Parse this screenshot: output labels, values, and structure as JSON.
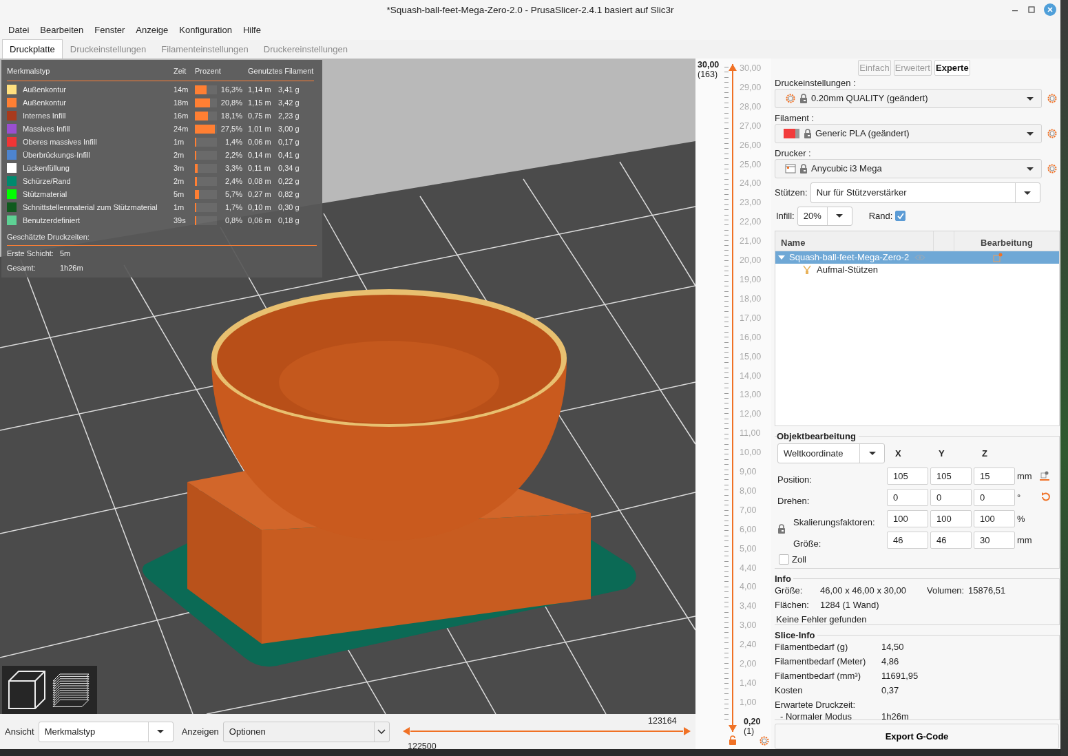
{
  "window": {
    "title": "*Squash-ball-feet-Mega-Zero-2.0 - PrusaSlicer-2.4.1 basiert auf Slic3r"
  },
  "menu": [
    "Datei",
    "Bearbeiten",
    "Fenster",
    "Anzeige",
    "Konfiguration",
    "Hilfe"
  ],
  "tabs": [
    {
      "label": "Druckplatte",
      "selected": true
    },
    {
      "label": "Druckeinstellungen",
      "selected": false
    },
    {
      "label": "Filamenteinstellungen",
      "selected": false
    },
    {
      "label": "Druckereinstellungen",
      "selected": false
    }
  ],
  "legend": {
    "columns": [
      "Merkmalstyp",
      "Zeit",
      "Prozent",
      "Genutztes Filament"
    ],
    "rows": [
      {
        "name": "Außenkontur",
        "color": "#ffe07f",
        "time": "14m",
        "level": 0.54,
        "percent": "16,3%",
        "length": "1,14 m",
        "weight": "3,41 g"
      },
      {
        "name": "Außenkontur",
        "color": "#ff7f33",
        "time": "18m",
        "level": 0.69,
        "percent": "20,8%",
        "length": "1,15 m",
        "weight": "3,42 g"
      },
      {
        "name": "Internes Infill",
        "color": "#a83a1c",
        "time": "16m",
        "level": 0.6,
        "percent": "18,1%",
        "length": "0,75 m",
        "weight": "2,23 g"
      },
      {
        "name": "Massives Infill",
        "color": "#9a4fd0",
        "time": "24m",
        "level": 0.92,
        "percent": "27,5%",
        "length": "1,01 m",
        "weight": "3,00 g"
      },
      {
        "name": "Oberes massives Infill",
        "color": "#f03535",
        "time": "1m",
        "level": 0.05,
        "percent": "1,4%",
        "length": "0,06 m",
        "weight": "0,17 g"
      },
      {
        "name": "Überbrückungs-Infill",
        "color": "#4d84cf",
        "time": "2m",
        "level": 0.07,
        "percent": "2,2%",
        "length": "0,14 m",
        "weight": "0,41 g"
      },
      {
        "name": "Lückenfüllung",
        "color": "#ffffff",
        "time": "3m",
        "level": 0.11,
        "percent": "3,3%",
        "length": "0,11 m",
        "weight": "0,34 g"
      },
      {
        "name": "Schürze/Rand",
        "color": "#008a6e",
        "time": "2m",
        "level": 0.08,
        "percent": "2,4%",
        "length": "0,08 m",
        "weight": "0,22 g"
      },
      {
        "name": "Stützmaterial",
        "color": "#00ff00",
        "time": "5m",
        "level": 0.19,
        "percent": "5,7%",
        "length": "0,27 m",
        "weight": "0,82 g"
      },
      {
        "name": "Schnittstellenmaterial zum Stützmaterial",
        "color": "#0f5a1e",
        "time": "1m",
        "level": 0.06,
        "percent": "1,7%",
        "length": "0,10 m",
        "weight": "0,30 g"
      },
      {
        "name": "Benutzerdefiniert",
        "color": "#5ed194",
        "time": "39s",
        "level": 0.03,
        "percent": "0,8%",
        "length": "0,06 m",
        "weight": "0,18 g"
      }
    ],
    "estimate_title": "Geschätzte Druckzeiten:",
    "estimates": [
      {
        "label": "Erste Schicht:",
        "value": "5m"
      },
      {
        "label": "Gesamt:",
        "value": "1h26m"
      }
    ]
  },
  "layer_slider": {
    "upper_thumb": {
      "value": "30,00",
      "layer": "(163)",
      "level": 1
    },
    "lower_thumb": {
      "value": "0,20",
      "layer": "(1)",
      "level": 0
    },
    "labels": [
      "30,00",
      "29,00",
      "28,00",
      "27,00",
      "26,00",
      "25,00",
      "24,00",
      "23,00",
      "22,00",
      "21,00",
      "20,00",
      "19,00",
      "18,00",
      "17,00",
      "16,00",
      "15,00",
      "14,00",
      "13,00",
      "12,00",
      "11,00",
      "10,00",
      "9,00",
      "8,00",
      "7,00",
      "6,00",
      "5,00",
      "4,40",
      "4,00",
      "3,40",
      "3,00",
      "2,40",
      "2,00",
      "1,40",
      "1,00"
    ]
  },
  "bottom_bar": {
    "view_label": "Ansicht",
    "view_value": "Merkmalstyp",
    "show_label": "Anzeigen",
    "show_value": "Optionen",
    "move_slider": {
      "start": {
        "value": "122500",
        "level": 0
      },
      "end": {
        "value": "123164",
        "level": 1
      }
    }
  },
  "modes": [
    {
      "label": "Einfach",
      "selected": false
    },
    {
      "label": "Erweitert",
      "selected": false
    },
    {
      "label": "Experte",
      "selected": true
    }
  ],
  "presets": [
    {
      "kind": "print",
      "label": "Druckeinstellungen :",
      "value": "0.20mm QUALITY (geändert)"
    },
    {
      "kind": "filament",
      "label": "Filament :",
      "value": "Generic PLA (geändert)"
    },
    {
      "kind": "printer",
      "label": "Drucker :",
      "value": "Anycubic i3 Mega"
    }
  ],
  "supports": {
    "label": "Stützen:",
    "value": "Nur für Stützverstärker"
  },
  "infill": {
    "label": "Infill:",
    "value": "20%"
  },
  "brim": {
    "label": "Rand:",
    "checked": true
  },
  "object_list": {
    "columns": [
      "Name",
      "Bearbeitung"
    ],
    "items": [
      {
        "name": "Squash-ball-feet-Mega-Zero-2",
        "selected": true,
        "expanded": true,
        "children": [
          {
            "name": "Aufmal-Stützen",
            "selected": false
          }
        ]
      }
    ]
  },
  "object_manipulation": {
    "title": "Objektbearbeitung",
    "coordinates": "Weltkoordinate",
    "axes": [
      "X",
      "Y",
      "Z"
    ],
    "rows": [
      {
        "kind": "position",
        "label": "Position:",
        "values": [
          "105",
          "105",
          "15"
        ],
        "unit": "mm"
      },
      {
        "kind": "rotation",
        "label": "Drehen:",
        "values": [
          "0",
          "0",
          "0"
        ],
        "unit": "°"
      },
      {
        "kind": "scale",
        "label": "Skalierungsfaktoren:",
        "values": [
          "100",
          "100",
          "100"
        ],
        "unit": "%"
      },
      {
        "kind": "size",
        "label": "Größe:",
        "values": [
          "46",
          "46",
          "30"
        ],
        "unit": "mm"
      }
    ],
    "inches": {
      "label": "Zoll",
      "checked": false
    }
  },
  "info": {
    "title": "Info",
    "size_label": "Größe:",
    "size": "46,00 x 46,00 x 30,00",
    "volume_label": "Volumen:",
    "volume": "15876,51",
    "facets_label": "Flächen:",
    "facets": "1284 (1 Wand)",
    "status": "Keine Fehler gefunden"
  },
  "slice_info": {
    "title": "Slice-Info",
    "rows": [
      {
        "label": "Filamentbedarf (g)",
        "value": "14,50"
      },
      {
        "label": "Filamentbedarf (Meter)",
        "value": "4,86"
      },
      {
        "label": "Filamentbedarf (mm³)",
        "value": "11691,95"
      },
      {
        "label": "Kosten",
        "value": "0,37"
      },
      {
        "label": "Erwartete Druckzeit:"
      },
      {
        "label": "- Normaler Modus",
        "value": "1h26m"
      }
    ]
  },
  "export_button": "Export G-Code"
}
